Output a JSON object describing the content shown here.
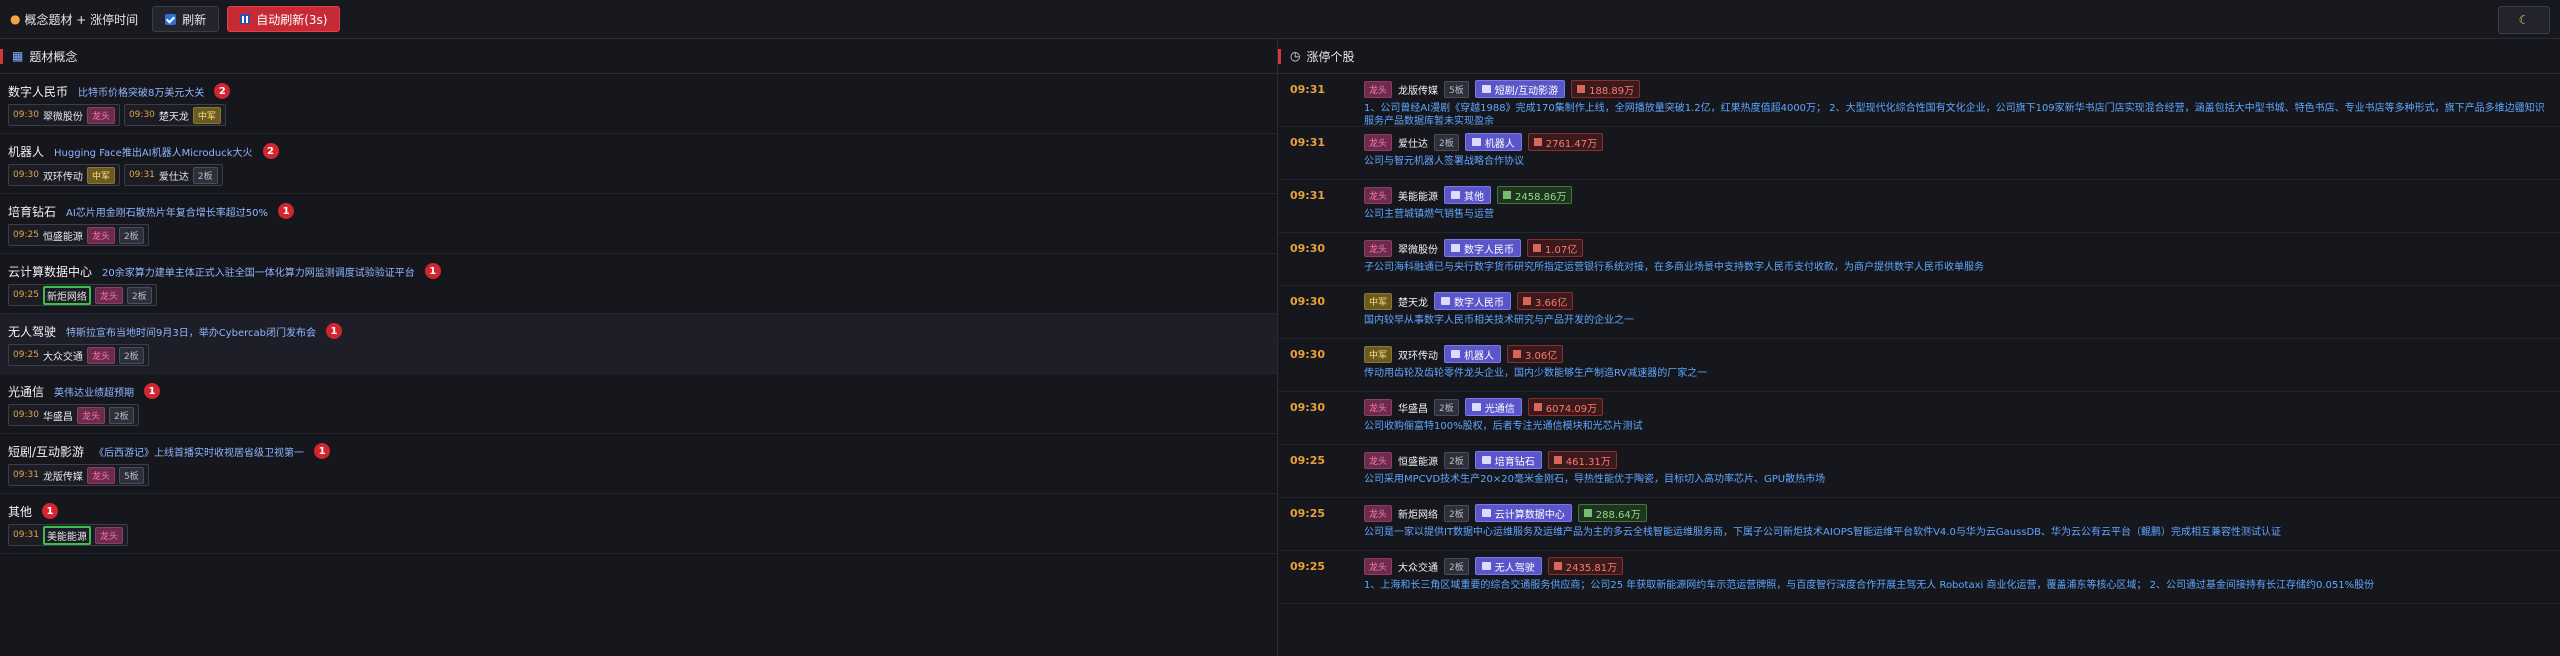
{
  "header": {
    "title": "概念题材 + 涨停时间",
    "refresh_label": "刷新",
    "auto_refresh_label": "自动刷新(3s)",
    "theme_icon": "moon-icon"
  },
  "left_panel": {
    "title": "题材概念",
    "concepts": [
      {
        "name": "数字人民币",
        "desc": "比特币价格突破8万美元大关",
        "count": "2",
        "chips": [
          {
            "time": "09:30",
            "name": "翠微股份",
            "tag": "龙头",
            "tagtype": "lt",
            "hl": false
          },
          {
            "time": "09:30",
            "name": "楚天龙",
            "tag": "中军",
            "tagtype": "zj",
            "hl": false
          }
        ]
      },
      {
        "name": "机器人",
        "desc": "Hugging Face推出AI机器人Microduck大火",
        "count": "2",
        "chips": [
          {
            "time": "09:30",
            "name": "双环传动",
            "tag": "中军",
            "tagtype": "zj",
            "hl": false
          },
          {
            "time": "09:31",
            "name": "爱仕达",
            "tag": "2板",
            "tagtype": "bd",
            "hl": false
          }
        ]
      },
      {
        "name": "培育钻石",
        "desc": "AI芯片用金刚石散热片年复合增长率超过50%",
        "count": "1",
        "chips": [
          {
            "time": "09:25",
            "name": "恒盛能源",
            "tag": "龙头",
            "tagtype": "lt",
            "tag2": "2板",
            "hl": false
          }
        ]
      },
      {
        "name": "云计算数据中心",
        "desc": "20余家算力建单主体正式入驻全国一体化算力网监测调度试验验证平台",
        "count": "1",
        "chips": [
          {
            "time": "09:25",
            "name": "新炬网络",
            "tag": "龙头",
            "tagtype": "lt",
            "tag2": "2板",
            "hl": true
          }
        ]
      },
      {
        "name": "无人驾驶",
        "desc": "特斯拉宣布当地时间9月3日，举办Cybercab闭门发布会",
        "count": "1",
        "chips": [
          {
            "time": "09:25",
            "name": "大众交通",
            "tag": "龙头",
            "tagtype": "lt",
            "tag2": "2板",
            "hl": false
          }
        ]
      },
      {
        "name": "光通信",
        "desc": "英伟达业绩超预期",
        "count": "1",
        "chips": [
          {
            "time": "09:30",
            "name": "华盛昌",
            "tag": "龙头",
            "tagtype": "lt",
            "tag2": "2板",
            "hl": false
          }
        ]
      },
      {
        "name": "短剧/互动影游",
        "desc": "《后西游记》上线首播实时收视居省级卫视第一",
        "count": "1",
        "chips": [
          {
            "time": "09:31",
            "name": "龙版传媒",
            "tag": "龙头",
            "tagtype": "lt",
            "tag2": "5板",
            "hl": false
          }
        ]
      },
      {
        "name": "其他",
        "desc": "",
        "count": "1",
        "chips": [
          {
            "time": "09:31",
            "name": "美能能源",
            "tag": "龙头",
            "tagtype": "lt",
            "hl": true
          }
        ]
      }
    ]
  },
  "right_panel": {
    "title": "涨停个股",
    "stocks": [
      {
        "time": "09:31",
        "tag": "龙头",
        "tagtype": "lt",
        "name": "龙版传媒",
        "board": "5板",
        "concept": "短剧/互动影游",
        "amount": "188.89万",
        "amt_color": "r",
        "desc": "1、公司曾经AI漫剧《穿越1988》完成170集制作上线，全网播放量突破1.2亿，红果热度值超4000万； 2、大型现代化综合性国有文化企业，公司旗下109家新华书店门店实现混合经营，涵盖包括大中型书城、特色书店、专业书店等多种形式，旗下产品多维边疆知识服务产品数据库暂未实现盈余"
      },
      {
        "time": "09:31",
        "tag": "龙头",
        "tagtype": "lt",
        "name": "爱仕达",
        "board": "2板",
        "concept": "机器人",
        "amount": "2761.47万",
        "amt_color": "r",
        "desc": "公司与智元机器人签署战略合作协议"
      },
      {
        "time": "09:31",
        "tag": "龙头",
        "tagtype": "lt",
        "name": "美能能源",
        "board": "",
        "concept": "其他",
        "amount": "2458.86万",
        "amt_color": "g",
        "desc": "公司主营城镇燃气销售与运营"
      },
      {
        "time": "09:30",
        "tag": "龙头",
        "tagtype": "lt",
        "name": "翠微股份",
        "board": "",
        "concept": "数字人民币",
        "amount": "1.07亿",
        "amt_color": "r",
        "desc": "子公司海科融通已与央行数字货币研究所指定运营银行系统对接，在多商业场景中支持数字人民币支付收款，为商户提供数字人民币收单服务"
      },
      {
        "time": "09:30",
        "tag": "中军",
        "tagtype": "zj",
        "name": "楚天龙",
        "board": "",
        "concept": "数字人民币",
        "amount": "3.66亿",
        "amt_color": "r",
        "desc": "国内较早从事数字人民币相关技术研究与产品开发的企业之一"
      },
      {
        "time": "09:30",
        "tag": "中军",
        "tagtype": "zj",
        "name": "双环传动",
        "board": "",
        "concept": "机器人",
        "amount": "3.06亿",
        "amt_color": "r",
        "desc": "传动用齿轮及齿轮零件龙头企业，国内少数能够生产制造RV减速器的厂家之一"
      },
      {
        "time": "09:30",
        "tag": "龙头",
        "tagtype": "lt",
        "name": "华盛昌",
        "board": "2板",
        "concept": "光通信",
        "amount": "6074.09万",
        "amt_color": "r",
        "desc": "公司收购俪富特100%股权，后者专注光通信模块和光芯片测试"
      },
      {
        "time": "09:25",
        "tag": "龙头",
        "tagtype": "lt",
        "name": "恒盛能源",
        "board": "2板",
        "concept": "培育钻石",
        "amount": "461.31万",
        "amt_color": "r",
        "desc": "公司采用MPCVD技术生产20×20毫米金刚石，导热性能优于陶瓷，目标切入高功率芯片、GPU散热市场"
      },
      {
        "time": "09:25",
        "tag": "龙头",
        "tagtype": "lt",
        "name": "新炬网络",
        "board": "2板",
        "concept": "云计算数据中心",
        "amount": "288.64万",
        "amt_color": "g",
        "desc": "公司是一家以提供IT数据中心运维服务及运维产品为主的多云全栈智能运维服务商，下属子公司新炬技术AIOPS智能运维平台软件V4.0与华为云GaussDB、华为云公有云平台（鲲鹏）完成相互兼容性测试认证"
      },
      {
        "time": "09:25",
        "tag": "龙头",
        "tagtype": "lt",
        "name": "大众交通",
        "board": "2板",
        "concept": "无人驾驶",
        "amount": "2435.81万",
        "amt_color": "r",
        "desc": "1、上海和长三角区域重要的综合交通服务供应商；公司25 年获取新能源网约车示范运营牌照，与百度智行深度合作开展主驾无人 Robotaxi 商业化运营，覆盖浦东等核心区域； 2、公司通过基金间接持有长江存储约0.051%股份"
      }
    ]
  }
}
